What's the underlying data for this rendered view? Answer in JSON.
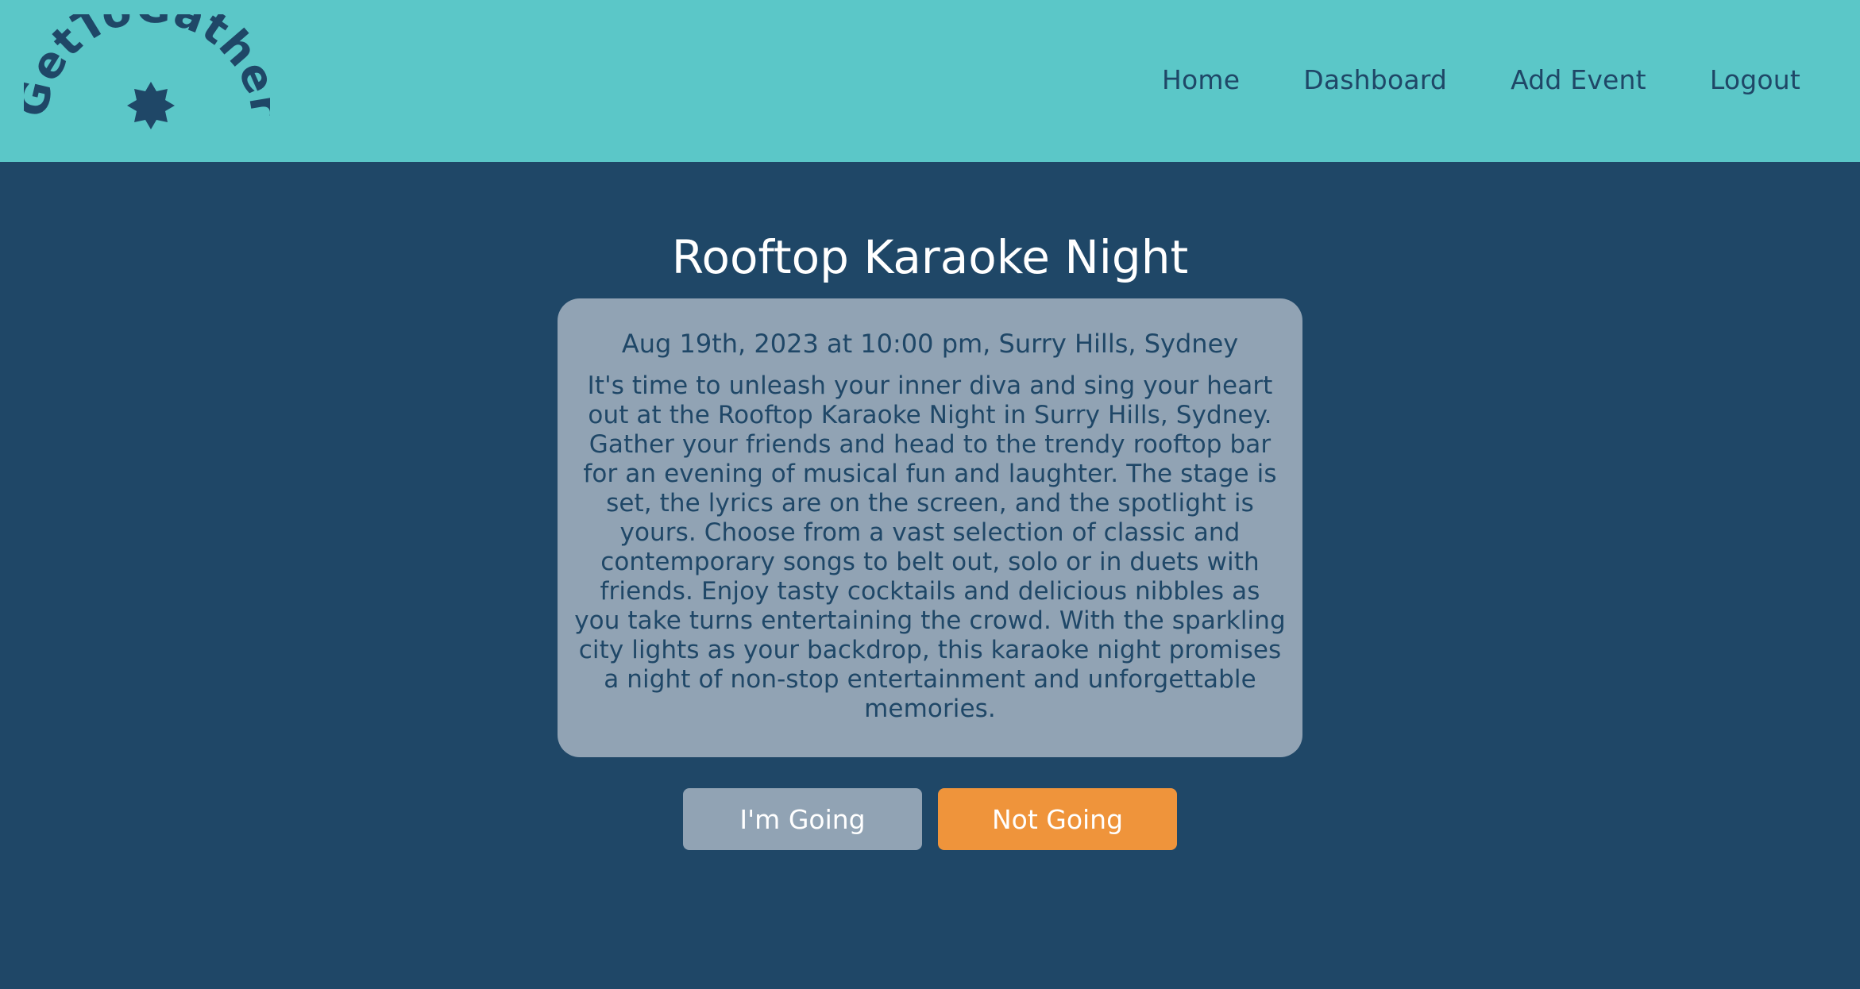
{
  "header": {
    "logo_text": "GetToGather",
    "nav": [
      {
        "label": "Home"
      },
      {
        "label": "Dashboard"
      },
      {
        "label": "Add Event"
      },
      {
        "label": "Logout"
      }
    ]
  },
  "event": {
    "title": "Rooftop Karaoke Night",
    "meta": "Aug 19th, 2023 at 10:00 pm, Surry Hills, Sydney",
    "description": "It's time to unleash your inner diva and sing your heart out at the Rooftop Karaoke Night in Surry Hills, Sydney. Gather your friends and head to the trendy rooftop bar for an evening of musical fun and laughter. The stage is set, the lyrics are on the screen, and the spotlight is yours. Choose from a vast selection of classic and contemporary songs to belt out, solo or in duets with friends. Enjoy tasty cocktails and delicious nibbles as you take turns entertaining the crowd. With the sparkling city lights as your backdrop, this karaoke night promises a night of non-stop entertainment and unforgettable memories."
  },
  "actions": {
    "going_label": "I'm Going",
    "not_going_label": "Not Going"
  },
  "colors": {
    "header_bg": "#5bc7c8",
    "page_bg": "#1f4767",
    "card_bg": "#91a3b4",
    "accent_orange": "#ef943b"
  }
}
